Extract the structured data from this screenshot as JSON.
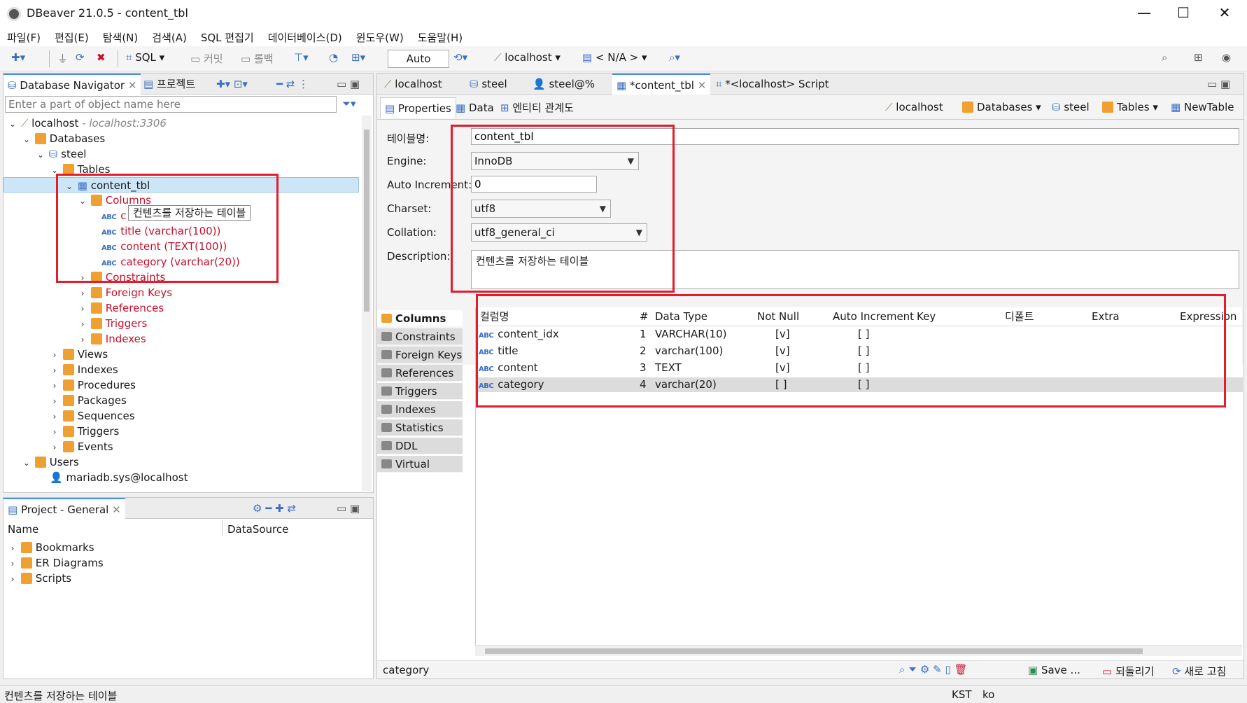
{
  "window": {
    "title": "DBeaver 21.0.5 - content_tbl",
    "min": "—",
    "max": "☐",
    "close": "✕"
  },
  "menu": [
    "파일(F)",
    "편집(E)",
    "탐색(N)",
    "검색(A)",
    "SQL 편집기",
    "데이터베이스(D)",
    "윈도우(W)",
    "도움말(H)"
  ],
  "toolbar": {
    "sql": "SQL",
    "commit": "커밋",
    "rollback": "롤백",
    "mode": "Auto",
    "datasource": "localhost",
    "schema": "< N/A >"
  },
  "navigator": {
    "tabs": [
      "Database Navigator",
      "프로젝트"
    ],
    "filter_placeholder": "Enter a part of object name here",
    "tree": {
      "conn": "localhost",
      "conn_host": "- localhost:3306",
      "databases": "Databases",
      "db": "steel",
      "tables": "Tables",
      "table": "content_tbl",
      "columns": "Columns",
      "col_items": [
        "title (varchar(100))",
        "content (TEXT(100))",
        "category (varchar(20))"
      ],
      "col_first": "c",
      "tooltip": "컨텐츠를 저장하는 테이블",
      "constraints": "Constraints",
      "fks": "Foreign Keys",
      "refs": "References",
      "triggers": "Triggers",
      "indexes": "Indexes",
      "views": "Views",
      "db_indexes": "Indexes",
      "procedures": "Procedures",
      "packages": "Packages",
      "sequences": "Sequences",
      "db_triggers": "Triggers",
      "events": "Events",
      "users": "Users",
      "user1": "mariadb.sys@localhost"
    }
  },
  "project": {
    "title": "Project - General",
    "col_name": "Name",
    "col_ds": "DataSource",
    "items": [
      "Bookmarks",
      "ER Diagrams",
      "Scripts"
    ]
  },
  "editor": {
    "tabs": [
      "localhost",
      "steel",
      "steel@%",
      "*content_tbl",
      "*<localhost> Script"
    ],
    "subtabs": [
      "Properties",
      "Data",
      "엔티티 관계도"
    ],
    "crumbs": [
      "localhost",
      "Databases",
      "steel",
      "Tables",
      "NewTable"
    ],
    "props": {
      "name_label": "테이블명:",
      "name": "content_tbl",
      "engine_label": "Engine:",
      "engine": "InnoDB",
      "ai_label": "Auto Increment:",
      "ai": "0",
      "charset_label": "Charset:",
      "charset": "utf8",
      "collation_label": "Collation:",
      "collation": "utf8_general_ci",
      "desc_label": "Description:",
      "desc": "컨텐츠를 저장하는 테이블"
    },
    "side_tabs": [
      "Columns",
      "Constraints",
      "Foreign Keys",
      "References",
      "Triggers",
      "Indexes",
      "Statistics",
      "DDL",
      "Virtual"
    ],
    "grid": {
      "headers": [
        "컬럼명",
        "#",
        "Data Type",
        "Not Null",
        "Auto Increment",
        "Key",
        "디폴트",
        "Extra",
        "Expression"
      ],
      "rows": [
        [
          "content_idx",
          "1",
          "VARCHAR(10)",
          "[v]",
          "[ ]"
        ],
        [
          "title",
          "2",
          "varchar(100)",
          "[v]",
          "[ ]"
        ],
        [
          "content",
          "3",
          "TEXT",
          "[v]",
          "[ ]"
        ],
        [
          "category",
          "4",
          "varchar(20)",
          "[ ]",
          "[ ]"
        ]
      ]
    },
    "footer": {
      "selected": "category",
      "save": "Save ...",
      "revert": "되돌리기",
      "refresh": "새로 고침"
    }
  },
  "status": {
    "text": "컨텐츠를 저장하는 테이블",
    "tz": "KST",
    "lang": "ko"
  },
  "colors": {
    "highlight": "#e01e2e",
    "selection": "#cde6f7",
    "accent": "#4a90d9"
  }
}
